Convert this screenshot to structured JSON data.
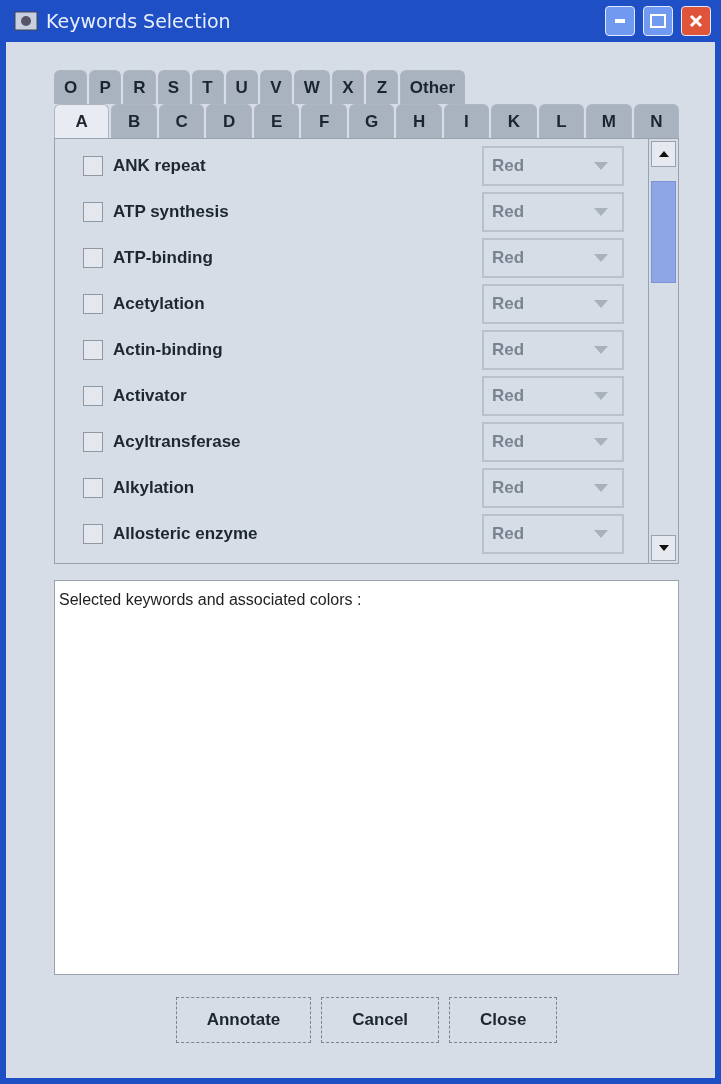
{
  "window": {
    "title": "Keywords Selection"
  },
  "tab_rows": [
    [
      {
        "label": "O",
        "selected": false
      },
      {
        "label": "P",
        "selected": false
      },
      {
        "label": "R",
        "selected": false
      },
      {
        "label": "S",
        "selected": false
      },
      {
        "label": "T",
        "selected": false
      },
      {
        "label": "U",
        "selected": false
      },
      {
        "label": "V",
        "selected": false
      },
      {
        "label": "W",
        "selected": false
      },
      {
        "label": "X",
        "selected": false
      },
      {
        "label": "Z",
        "selected": false
      },
      {
        "label": "Other",
        "selected": false
      }
    ],
    [
      {
        "label": "A",
        "selected": true
      },
      {
        "label": "B",
        "selected": false
      },
      {
        "label": "C",
        "selected": false
      },
      {
        "label": "D",
        "selected": false
      },
      {
        "label": "E",
        "selected": false
      },
      {
        "label": "F",
        "selected": false
      },
      {
        "label": "G",
        "selected": false
      },
      {
        "label": "H",
        "selected": false
      },
      {
        "label": "I",
        "selected": false
      },
      {
        "label": "K",
        "selected": false
      },
      {
        "label": "L",
        "selected": false
      },
      {
        "label": "M",
        "selected": false
      },
      {
        "label": "N",
        "selected": false
      }
    ]
  ],
  "keywords": [
    {
      "label": "ANK repeat",
      "checked": false,
      "choice": "Red",
      "choice_disabled": true
    },
    {
      "label": "ATP synthesis",
      "checked": false,
      "choice": "Red",
      "choice_disabled": true
    },
    {
      "label": "ATP-binding",
      "checked": false,
      "choice": "Red",
      "choice_disabled": true
    },
    {
      "label": "Acetylation",
      "checked": false,
      "choice": "Red",
      "choice_disabled": true
    },
    {
      "label": "Actin-binding",
      "checked": false,
      "choice": "Red",
      "choice_disabled": true
    },
    {
      "label": "Activator",
      "checked": false,
      "choice": "Red",
      "choice_disabled": true
    },
    {
      "label": "Acyltransferase",
      "checked": false,
      "choice": "Red",
      "choice_disabled": true
    },
    {
      "label": "Alkylation",
      "checked": false,
      "choice": "Red",
      "choice_disabled": true
    },
    {
      "label": "Allosteric enzyme",
      "checked": false,
      "choice": "Red",
      "choice_disabled": true
    }
  ],
  "selected_area": {
    "heading": "Selected keywords and associated colors :"
  },
  "buttons": [
    "Annotate",
    "Cancel",
    "Close"
  ]
}
